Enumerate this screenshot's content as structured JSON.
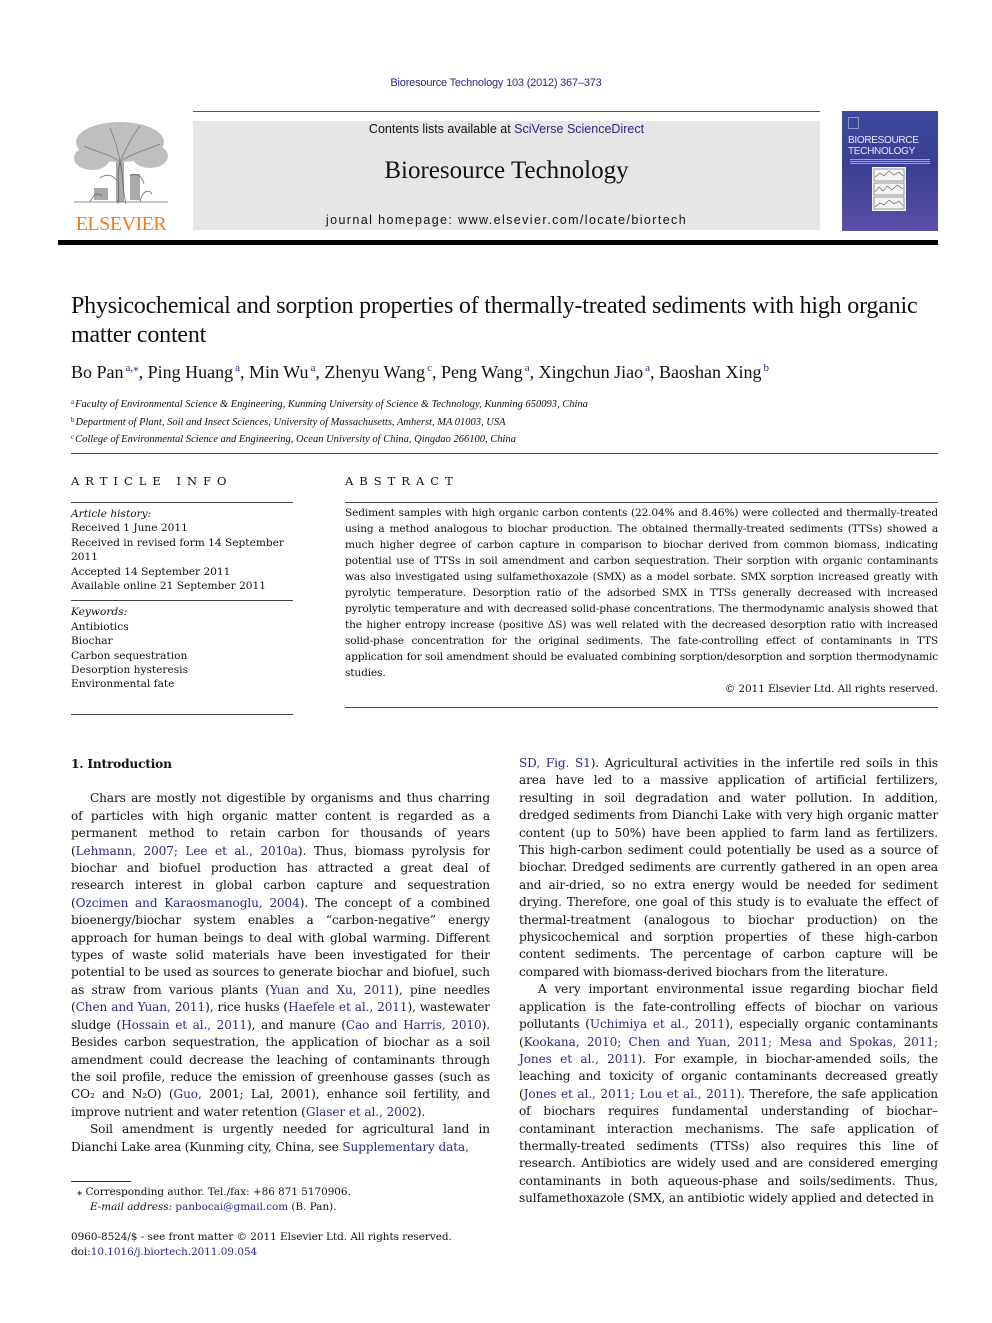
{
  "running_head": "Bioresource Technology 103 (2012) 367–373",
  "publisher": {
    "logo_text": "ELSEVIER",
    "logo_color": "#f07d1e"
  },
  "banner": {
    "contents_prefix": "Contents lists available at ",
    "contents_link": "SciVerse ScienceDirect",
    "journal_title": "Bioresource Technology",
    "homepage_label": "journal homepage: ",
    "homepage_url": "www.elsevier.com/locate/biortech"
  },
  "cover": {
    "title_line1": "BIORESOURCE",
    "title_line2": "TECHNOLOGY"
  },
  "article": {
    "title": "Physicochemical and sorption properties of thermally-treated sediments with high organic matter content",
    "authors": [
      {
        "name": "Bo Pan",
        "sup": "a,⁎"
      },
      {
        "name": "Ping Huang",
        "sup": "a"
      },
      {
        "name": "Min Wu",
        "sup": "a"
      },
      {
        "name": "Zhenyu Wang",
        "sup": "c"
      },
      {
        "name": "Peng Wang",
        "sup": "a"
      },
      {
        "name": "Xingchun Jiao",
        "sup": "a"
      },
      {
        "name": "Baoshan Xing",
        "sup": "b"
      }
    ],
    "affiliations": [
      {
        "sup": "a",
        "text": "Faculty of Environmental Science & Engineering, Kunming University of Science & Technology, Kunming 650093, China"
      },
      {
        "sup": "b",
        "text": "Department of Plant, Soil and Insect Sciences, University of Massachusetts, Amherst, MA 01003, USA"
      },
      {
        "sup": "c",
        "text": "College of Environmental Science and Engineering, Ocean University of China, Qingdao 266100, China"
      }
    ]
  },
  "article_info": {
    "heading": "ARTICLE INFO",
    "history_label": "Article history:",
    "history": [
      "Received 1 June 2011",
      "Received in revised form 14 September 2011",
      "Accepted 14 September 2011",
      "Available online 21 September 2011"
    ],
    "keywords_label": "Keywords:",
    "keywords": [
      "Antibiotics",
      "Biochar",
      "Carbon sequestration",
      "Desorption hysteresis",
      "Environmental fate"
    ]
  },
  "abstract": {
    "heading": "ABSTRACT",
    "text": "Sediment samples with high organic carbon contents (22.04% and 8.46%) were collected and thermally-treated using a method analogous to biochar production. The obtained thermally-treated sediments (TTSs) showed a much higher degree of carbon capture in comparison to biochar derived from common biomass, indicating potential use of TTSs in soil amendment and carbon sequestration. Their sorption with organic contaminants was also investigated using sulfamethoxazole (SMX) as a model sorbate. SMX sorption increased greatly with pyrolytic temperature. Desorption ratio of the adsorbed SMX in TTSs generally decreased with increased pyrolytic temperature and with decreased solid-phase concentrations. The thermodynamic analysis showed that the higher entropy increase (positive ΔS) was well related with the decreased desorption ratio with increased solid-phase concentration for the original sediments. The fate-controlling effect of contaminants in TTS application for soil amendment should be evaluated combining sorption/desorption and sorption thermodynamic studies.",
    "copyright": "© 2011 Elsevier Ltd. All rights reserved."
  },
  "introduction": {
    "heading": "1. Introduction",
    "p1": [
      {
        "t": "Chars are mostly not digestible by organisms and thus charring of particles with high organic matter content is regarded as a permanent method to retain carbon for thousands of years ("
      },
      {
        "l": "Lehmann, 2007; Lee et al., 2010a"
      },
      {
        "t": "). Thus, biomass pyrolysis for biochar and biofuel production has attracted a great deal of research interest in global carbon capture and sequestration ("
      },
      {
        "l": "Ozcimen and Karaosmanoglu, 2004"
      },
      {
        "t": "). The concept of a combined bioenergy/biochar system enables a “carbon-negative” energy approach for human beings to deal with global warming. Different types of waste solid materials have been investigated for their potential to be used as sources to generate biochar and biofuel, such as straw from various plants ("
      },
      {
        "l": "Yuan and Xu, 2011"
      },
      {
        "t": "), pine needles ("
      },
      {
        "l": "Chen and Yuan, 2011"
      },
      {
        "t": "), rice husks ("
      },
      {
        "l": "Haefele et al., 2011"
      },
      {
        "t": "), wastewater sludge ("
      },
      {
        "l": "Hossain et al., 2011"
      },
      {
        "t": "), and manure ("
      },
      {
        "l": "Cao and Harris, 2010"
      },
      {
        "t": "). Besides carbon sequestration, the application of biochar as a soil amendment could decrease the leaching of contaminants through the soil profile, reduce the emission of greenhouse gasses (such as CO₂ and N₂O) ("
      },
      {
        "l": "Guo,"
      },
      {
        "t": " 2001; Lal, 2001), enhance soil fertility, and improve nutrient and water retention ("
      },
      {
        "l": "Glaser et al., 2002"
      },
      {
        "t": ")."
      }
    ],
    "p2": [
      {
        "t": "Soil amendment is urgently needed for agricultural land in Dianchi Lake area (Kunming city, China, see "
      },
      {
        "l": "Supplementary data, SD, Fig. S1"
      },
      {
        "t": "). Agricultural activities in the infertile red soils in this area have led to a massive application of artificial fertilizers, resulting in soil degradation and water pollution. In addition, dredged sediments from Dianchi Lake with very high organic matter content (up to 50%) have been applied to farm land as fertilizers. This high-carbon sediment could potentially be used as a source of biochar. Dredged sediments are currently gathered in an open area and air-dried, so no extra energy would be needed for sediment drying. Therefore, one goal of this study is to evaluate the effect of thermal-treatment (analogous to biochar production) on the physicochemical and sorption properties of these high-carbon content sediments. The percentage of carbon capture will be compared with biomass-derived biochars from the literature."
      }
    ],
    "p3": [
      {
        "t": "A very important environmental issue regarding biochar field application is the fate-controlling effects of biochar on various pollutants ("
      },
      {
        "l": "Uchimiya et al., 2011"
      },
      {
        "t": "), especially organic contaminants ("
      },
      {
        "l": "Kookana, 2010; Chen and Yuan, 2011; Mesa and Spokas, 2011; Jones et al., 2011"
      },
      {
        "t": "). For example, in biochar-amended soils, the leaching and toxicity of organic contaminants decreased greatly ("
      },
      {
        "l": "Jones et al., 2011; Lou et al., 2011"
      },
      {
        "t": "). Therefore, the safe application of biochars requires fundamental understanding of biochar–contaminant interaction mechanisms. The safe application of thermally-treated sediments (TTSs) also requires this line of research. Antibiotics are widely used and are considered emerging contaminants in both aqueous-phase and soils/sediments. Thus, sulfamethoxazole (SMX, an antibiotic widely applied and detected in"
      }
    ]
  },
  "footnote": {
    "corresponding": "⁎  Corresponding author. Tel./fax: +86 871 5170906.",
    "email_label": "E-mail address: ",
    "email": "panbocai@gmail.com",
    "email_suffix": " (B. Pan)."
  },
  "bottom": {
    "issn_line": "0960-8524/$ - see front matter © 2011 Elsevier Ltd. All rights reserved.",
    "doi_label": "doi:",
    "doi": "10.1016/j.biortech.2011.09.054"
  },
  "colors": {
    "link": "#2a2a86",
    "banner_bg": "#e6e6e6",
    "elsevier_orange": "#f07d1e"
  }
}
